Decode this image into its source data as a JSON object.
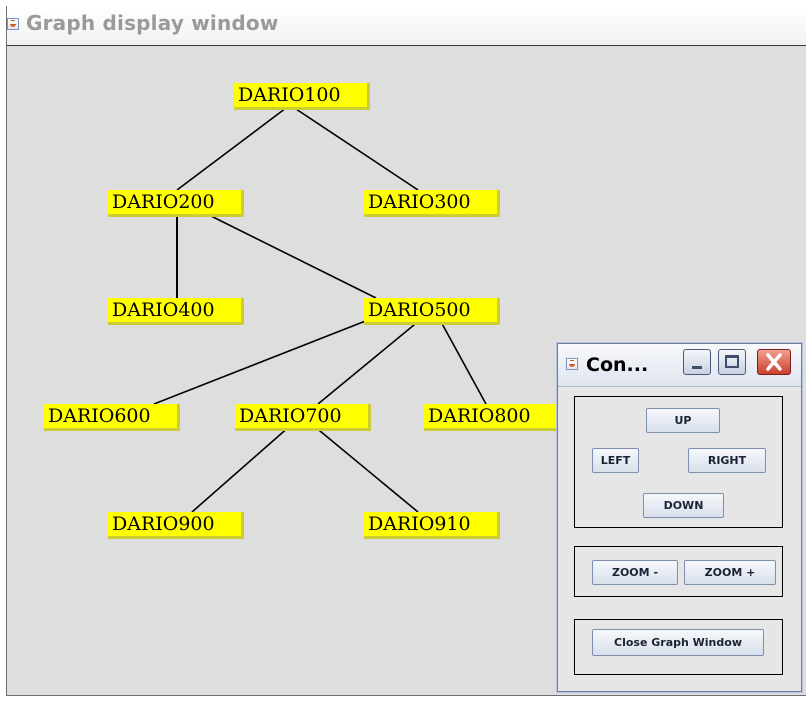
{
  "main_window": {
    "title": "Graph display window"
  },
  "graph": {
    "nodes": [
      {
        "id": "node-1",
        "label": "DARIO100"
      },
      {
        "id": "node-2",
        "label": "DARIO200"
      },
      {
        "id": "node-3",
        "label": "DARIO300"
      },
      {
        "id": "node-4",
        "label": "DARIO400"
      },
      {
        "id": "node-5",
        "label": "DARIO500"
      },
      {
        "id": "node-6",
        "label": "DARIO600"
      },
      {
        "id": "node-7",
        "label": "DARIO700"
      },
      {
        "id": "node-8",
        "label": "DARIO800"
      },
      {
        "id": "node-9",
        "label": "DARIO900"
      },
      {
        "id": "node-10",
        "label": "DARIO910"
      }
    ],
    "edges": [
      [
        "DARIO100",
        "DARIO200"
      ],
      [
        "DARIO100",
        "DARIO300"
      ],
      [
        "DARIO200",
        "DARIO400"
      ],
      [
        "DARIO200",
        "DARIO500"
      ],
      [
        "DARIO500",
        "DARIO600"
      ],
      [
        "DARIO500",
        "DARIO700"
      ],
      [
        "DARIO500",
        "DARIO800"
      ],
      [
        "DARIO700",
        "DARIO900"
      ],
      [
        "DARIO700",
        "DARIO910"
      ]
    ],
    "node_color": "#ffff00",
    "edge_color": "#000000",
    "background_color": "#dedede"
  },
  "control_window": {
    "title": "Con...",
    "buttons": {
      "up": "UP",
      "left": "LEFT",
      "right": "RIGHT",
      "down": "DOWN",
      "zoom_out": "ZOOM -",
      "zoom_in": "ZOOM +",
      "close_graph": "Close Graph Window"
    }
  }
}
